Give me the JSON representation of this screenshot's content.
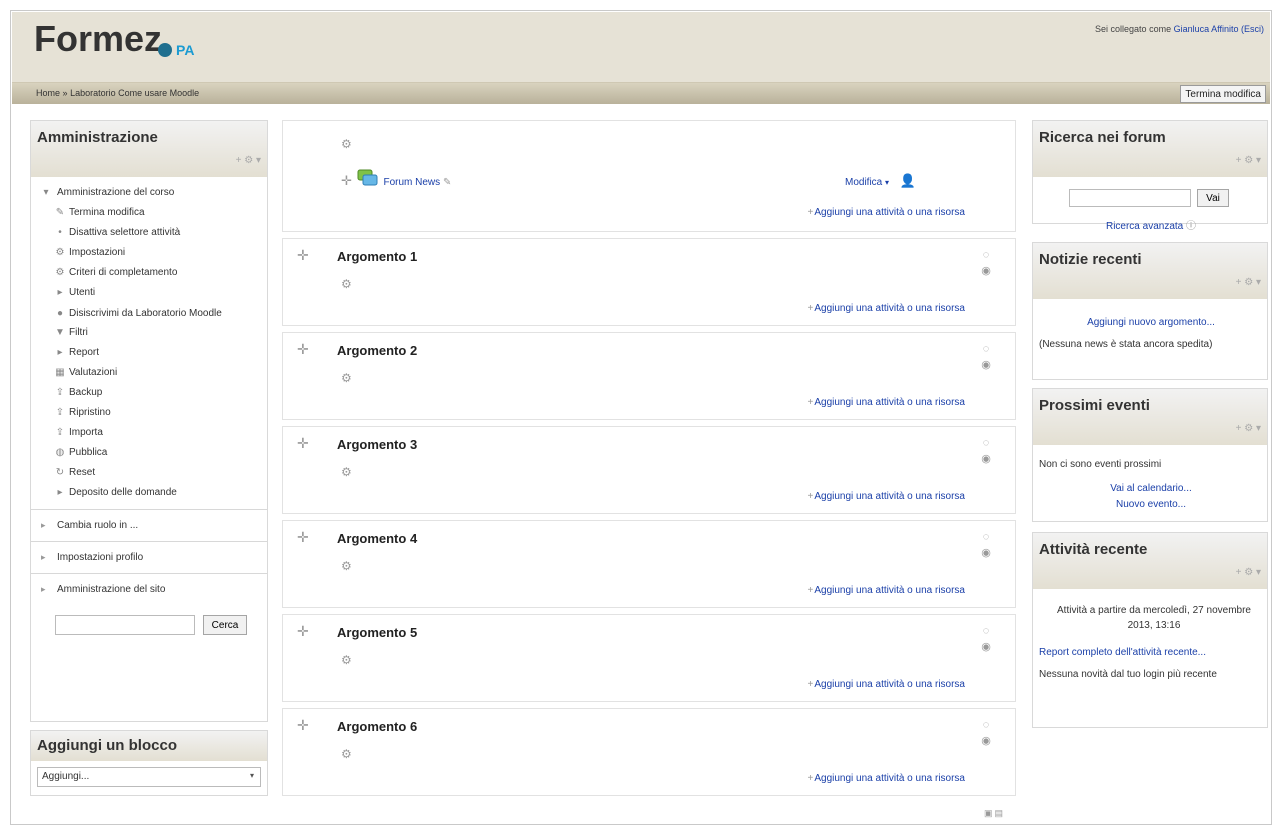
{
  "header": {
    "logo_main": "Formez",
    "logo_suffix": "PA",
    "login_prefix": "Sei collegato come",
    "user_name": "Gianluca Affinito",
    "logout": "(Esci)"
  },
  "nav": {
    "breadcrumb_home": "Home",
    "breadcrumb_sep": "»",
    "breadcrumb_course": "Laboratorio Come usare Moodle",
    "termina_modifica": "Termina modifica"
  },
  "admin": {
    "title": "Amministrazione",
    "controls": "+ ⚙ ▾",
    "course_admin": "Amministrazione del corso",
    "items": [
      {
        "label": "Termina modifica",
        "icon": "pencil-icon",
        "glyph": "✎"
      },
      {
        "label": "Disattiva selettore attività",
        "icon": "bullet-icon",
        "glyph": "•"
      },
      {
        "label": "Impostazioni",
        "icon": "gear-icon",
        "glyph": "⚙"
      },
      {
        "label": "Criteri di completamento",
        "icon": "gear-icon",
        "glyph": "⚙"
      },
      {
        "label": "Utenti",
        "icon": "expand-icon",
        "glyph": "▸"
      },
      {
        "label": "Disiscrivimi da Laboratorio Moodle",
        "icon": "user-icon",
        "glyph": "👤"
      },
      {
        "label": "Filtri",
        "icon": "filter-icon",
        "glyph": "⏷"
      },
      {
        "label": "Report",
        "icon": "expand-icon",
        "glyph": "▸"
      },
      {
        "label": "Valutazioni",
        "icon": "table-icon",
        "glyph": "▦"
      },
      {
        "label": "Backup",
        "icon": "backup-icon",
        "glyph": "⇪"
      },
      {
        "label": "Ripristino",
        "icon": "restore-icon",
        "glyph": "⇪"
      },
      {
        "label": "Importa",
        "icon": "import-icon",
        "glyph": "⇪"
      },
      {
        "label": "Pubblica",
        "icon": "globe-icon",
        "glyph": "◍"
      },
      {
        "label": "Reset",
        "icon": "reset-icon",
        "glyph": "↻"
      },
      {
        "label": "Deposito delle domande",
        "icon": "expand-icon",
        "glyph": "▸"
      }
    ],
    "cambia_ruolo": "Cambia ruolo in ...",
    "impostazioni_profilo": "Impostazioni profilo",
    "amministrazione_sito": "Amministrazione del sito",
    "search_button": "Cerca"
  },
  "add_block": {
    "title": "Aggiungi un blocco",
    "select_value": "Aggiungi..."
  },
  "course": {
    "forum_name": "Forum News",
    "modifica": "Modifica",
    "add_activity": "Aggiungi una attività o una risorsa",
    "sections": [
      {
        "title": "Argomento 1"
      },
      {
        "title": "Argomento 2"
      },
      {
        "title": "Argomento 3"
      },
      {
        "title": "Argomento 4"
      },
      {
        "title": "Argomento 5"
      },
      {
        "title": "Argomento 6"
      }
    ]
  },
  "forum_search": {
    "title": "Ricerca nei forum",
    "button": "Vai",
    "advanced": "Ricerca avanzata"
  },
  "news": {
    "title": "Notizie recenti",
    "add_topic": "Aggiungi nuovo argomento...",
    "empty": "(Nessuna news è stata ancora spedita)"
  },
  "events": {
    "title": "Prossimi eventi",
    "empty": "Non ci sono eventi prossimi",
    "calendar": "Vai al calendario...",
    "new_event": "Nuovo evento..."
  },
  "recent": {
    "title": "Attività recente",
    "since": "Attività a partire da mercoledì, 27 novembre 2013, 13:16",
    "full_report": "Report completo dell'attività recente...",
    "no_news": "Nessuna novità dal tuo login più recente"
  },
  "colors": {
    "link": "#1a3fa8",
    "header_bg": "#e6e2d6",
    "nav_bg": "#b9b19a"
  }
}
